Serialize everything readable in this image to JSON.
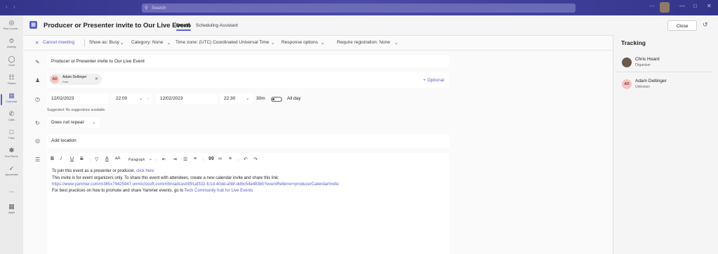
{
  "titlebar": {
    "search_placeholder": "Search"
  },
  "rail": {
    "items": [
      {
        "label": "Viva Conne...",
        "icon": "viva-icon"
      },
      {
        "label": "Activity",
        "icon": "bell-icon"
      },
      {
        "label": "Chat",
        "icon": "chat-icon"
      },
      {
        "label": "Teams",
        "icon": "teams-icon"
      },
      {
        "label": "Calendar",
        "icon": "calendar-icon"
      },
      {
        "label": "Calls",
        "icon": "phone-icon"
      },
      {
        "label": "Files",
        "icon": "file-icon"
      },
      {
        "label": "Eco Demo",
        "icon": "eco-icon"
      },
      {
        "label": "Approvals",
        "icon": "approvals-icon"
      },
      {
        "label": "Apps",
        "icon": "apps-icon"
      }
    ],
    "more": "..."
  },
  "header": {
    "title": "Producer or Presenter invite to Our Live Event",
    "tabs": [
      "Details",
      "Scheduling Assistant"
    ],
    "close_label": "Close"
  },
  "toolbar": {
    "cancel": "Cancel meeting",
    "show_as": "Show as: Busy",
    "category": "Category: None",
    "timezone": "Time zone: (UTC) Coordinated Universal Time",
    "response": "Response options",
    "registration": "Require registration: None"
  },
  "form": {
    "title": "Producer or Presenter invite to Our Live Event",
    "attendee": {
      "initials": "AD",
      "name": "Adam Deltinger",
      "status": "Free"
    },
    "optional": "+ Optional",
    "start_date": "12/02/2023",
    "start_time": "22:00",
    "end_date": "12/02/2023",
    "end_time": "22:30",
    "duration": "30m",
    "all_day": "All day",
    "suggestion": "Suggested: No suggestions available.",
    "repeat": "Does not repeat",
    "location_placeholder": "Add location"
  },
  "editor": {
    "paragraph": "Paragraph",
    "line1_text": "To join this event as a presenter or producer,",
    "line1_link": "click here",
    "line2": "This invite is for event organizers only. To share this event with attendees, create a new calendar invite and share this link:",
    "line3_link": "https://www.yammer.com/m365x79425947.onmicrosoft.com/#/broadcast/891af332-fc1d-40dd-a5bf-ddbc54e483b0?eventReferrer=producerCalendarInvite",
    "line4_text": "For best practices on how to promote and share Yammer events, go to",
    "line4_link": "Tech Community hub for Live Events"
  },
  "tracking": {
    "title": "Tracking",
    "people": [
      {
        "name": "Chris Hoard",
        "role": "Organizer"
      },
      {
        "initials": "AD",
        "name": "Adam Deltinger",
        "role": "Unknown"
      }
    ]
  },
  "colors": {
    "accent": "#5b5fc7",
    "titlebar": "#3b3a8e"
  }
}
